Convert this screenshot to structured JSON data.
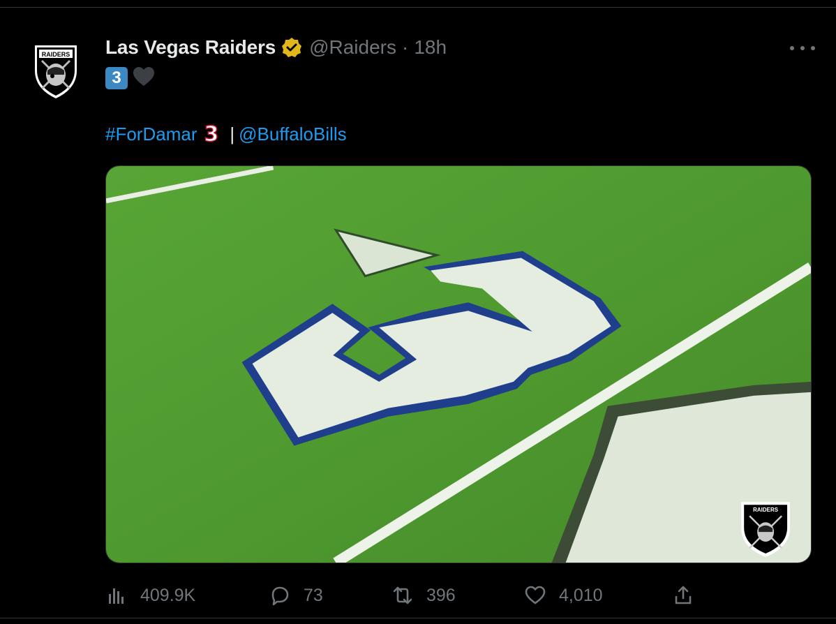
{
  "tweet": {
    "display_name": "Las Vegas Raiders",
    "handle": "@Raiders",
    "separator": "·",
    "time": "18h",
    "emoji_number": "3",
    "hashtag": "#ForDamar",
    "jersey_number": "3",
    "separator_bar": "|",
    "mention": "@BuffaloBills",
    "logo_text": "RAIDERS"
  },
  "media": {
    "description_icon": "field-number-3-image",
    "watermark_text": "RAIDERS"
  },
  "actions": {
    "views": "409.9K",
    "replies": "73",
    "retweets": "396",
    "likes": "4,010"
  },
  "colors": {
    "accent": "#1d9bf0",
    "muted": "#71767b",
    "verified_gold": "#e2b719",
    "field_green": "#4f9a2f",
    "bills_blue": "#1f3e8c"
  }
}
